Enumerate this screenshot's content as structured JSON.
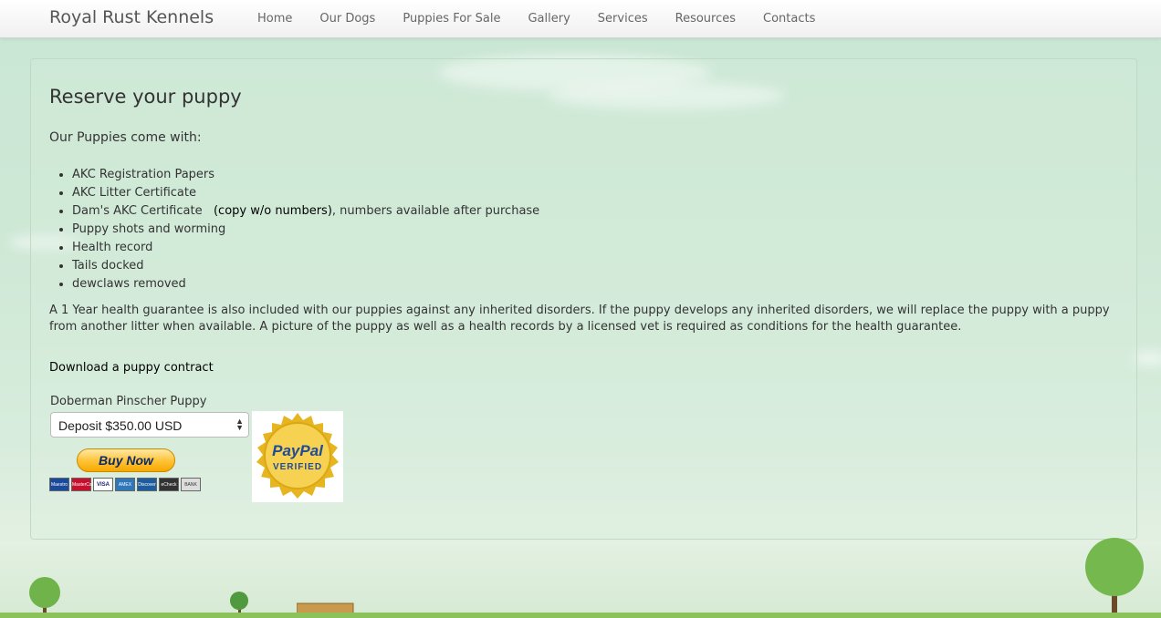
{
  "brand": "Royal Rust Kennels",
  "nav": [
    "Home",
    "Our Dogs",
    "Puppies For Sale",
    "Gallery",
    "Services",
    "Resources",
    "Contacts"
  ],
  "page_title": "Reserve your puppy",
  "intro": "Our Puppies come with:",
  "features": {
    "f1": "AKC Registration Papers",
    "f2": "AKC Litter Certificate",
    "f3_a": "Dam's AKC Certificate",
    "f3_b": "(copy w/o numbers)",
    "f3_c": ", numbers available after purchase",
    "f4": "Puppy shots and worming",
    "f5": "Health record",
    "f6": "Tails docked",
    "f7": "dewclaws removed"
  },
  "guarantee": "A 1 Year health guarantee is also included with our puppies against any inherited disorders. If the puppy develops any inherited disorders, we will replace the puppy with a puppy from another litter when available. A picture of the puppy as well as a health records by a licensed vet is required as conditions for the health guarantee.",
  "download_link": "Download a puppy contract",
  "paypal": {
    "product_title": "Doberman Pinscher Puppy",
    "selected_option": "Deposit $350.00 USD",
    "buy_label": "Buy Now",
    "cards": [
      "Maestro",
      "MasterCard",
      "VISA",
      "AMEX",
      "Discover",
      "eCheck",
      "BANK"
    ],
    "seal_brand": "PayPal",
    "seal_text": "VERIFIED"
  },
  "colors": {
    "paypal_blue": "#1f4b97",
    "seal_gold": "#f2c12e",
    "ground_green": "#8cc25a"
  }
}
